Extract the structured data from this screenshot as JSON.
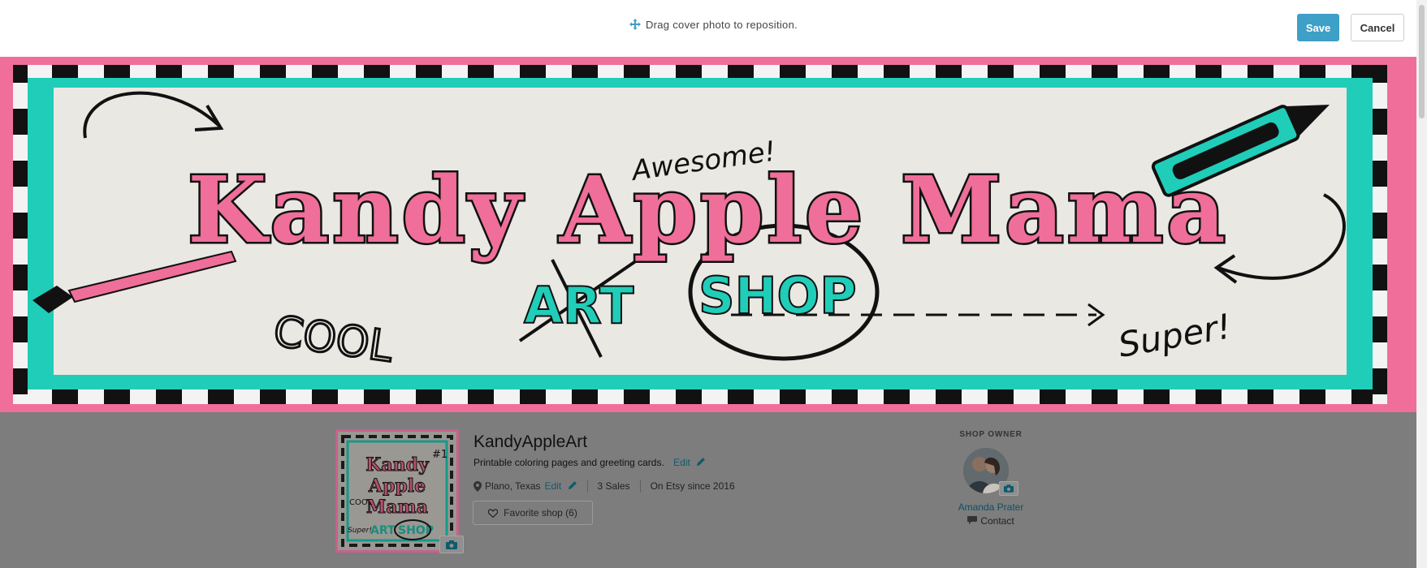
{
  "toolbar": {
    "hint": "Drag cover photo to reposition.",
    "save_label": "Save",
    "cancel_label": "Cancel",
    "accent_color": "#3e9fc7"
  },
  "cover": {
    "title": "Kandy Apple Mama",
    "art": "ART",
    "shop": "SHOP",
    "word_awesome": "Awesome!",
    "word_cool": "COOL",
    "word_super": "Super!",
    "colors": {
      "pink": "#f06e9a",
      "teal": "#20cdb9",
      "paper": "#e9e8e2"
    }
  },
  "shop": {
    "name": "KandyAppleArt",
    "description": "Printable coloring pages and greeting cards.",
    "edit_label": "Edit",
    "location": "Plano, Texas",
    "sales": "3 Sales",
    "since": "On Etsy since 2016",
    "favorite_label": "Favorite shop (6)",
    "avatar": {
      "line1": "Kandy",
      "line2": "Apple",
      "line3": "Mama",
      "art": "ART",
      "shop": "SHOP",
      "cool": "COOL",
      "super": "Super!",
      "badge": "#1"
    }
  },
  "owner": {
    "label": "SHOP OWNER",
    "name": "Amanda Prater",
    "contact_label": "Contact"
  }
}
